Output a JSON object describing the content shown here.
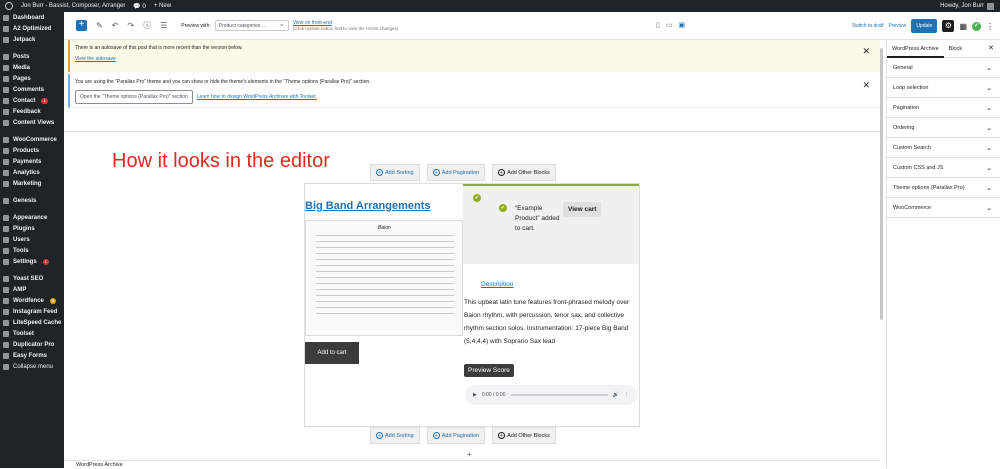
{
  "adminbar": {
    "site_name": "Jon Burr - Bassist, Composer, Arranger",
    "comments_count": "0",
    "new_label": "+ New",
    "howdy": "Howdy, Jon Burr"
  },
  "sidebar": {
    "items": [
      {
        "label": "Dashboard"
      },
      {
        "label": "A2 Optimized"
      },
      {
        "label": "Jetpack"
      },
      {
        "label": "Posts"
      },
      {
        "label": "Media"
      },
      {
        "label": "Pages"
      },
      {
        "label": "Comments"
      },
      {
        "label": "Contact",
        "badge": "1"
      },
      {
        "label": "Feedback"
      },
      {
        "label": "Content Views"
      },
      {
        "label": "WooCommerce"
      },
      {
        "label": "Products"
      },
      {
        "label": "Payments"
      },
      {
        "label": "Analytics"
      },
      {
        "label": "Marketing"
      },
      {
        "label": "Genesis"
      },
      {
        "label": "Appearance"
      },
      {
        "label": "Plugins"
      },
      {
        "label": "Users"
      },
      {
        "label": "Tools"
      },
      {
        "label": "Settings",
        "badge": "1"
      },
      {
        "label": "Yoast SEO"
      },
      {
        "label": "AMP"
      },
      {
        "label": "Wordfence",
        "badge": "8"
      },
      {
        "label": "Instagram Feed"
      },
      {
        "label": "LiteSpeed Cache"
      },
      {
        "label": "Toolset"
      },
      {
        "label": "Duplicator Pro"
      },
      {
        "label": "Easy Forms"
      },
      {
        "label": "Collapse menu"
      }
    ]
  },
  "topbar": {
    "preview_with_label": "Preview with:",
    "preview_select_value": "Product categories ...",
    "view_frontend": "View on front-end",
    "view_frontend_hint": "(Click Update button first to view the recent changes)",
    "switch_to_draft": "Switch to draft",
    "preview": "Preview",
    "update": "Update"
  },
  "notices": {
    "autosave_text": "There is an autosave of this post that is more recent than the version below.",
    "autosave_link": "View the autosave",
    "theme_text": "You are using the \"Parallax Pro\" theme and you can show or hide the theme's elements in the \"Theme options (Parallax Pro)\" section.",
    "theme_button": "Open the \"Theme options (Parallax Pro)\" section",
    "theme_link": "Learn how to design WordPress Archives with Toolset."
  },
  "editor": {
    "annotation": "How it looks in the editor",
    "add_sorting": "Add Sorting",
    "add_pagination": "Add Pagination",
    "add_other_blocks": "Add Other Blocks",
    "product_title": "Big Band Arrangements",
    "add_to_cart": "Add to cart",
    "cart_message": "“Example Product” added to cart.",
    "view_cart": "View cart",
    "description_link": "Description",
    "description": "This upbeat latin tune features front-phrased melody over Baion rhythm, with percussion, tenor sax, and collective rhythm section solos. Instrumentation: 17-piece Big Band (5,4,4,4) with Soprano Sax lead",
    "preview_score": "Preview Score",
    "audio_time": "0:00 / 0:00",
    "score_title": "Baion",
    "inserter": "+"
  },
  "footer": {
    "breadcrumb": "WordPress Archive"
  },
  "panel": {
    "tab_archive": "WordPress Archive",
    "tab_block": "Block",
    "sections": [
      "General",
      "Loop selection",
      "Pagination",
      "Ordering",
      "Custom Search",
      "Custom CSS and JS",
      "Theme options (Parallax Pro)",
      "WooCommerce"
    ]
  }
}
